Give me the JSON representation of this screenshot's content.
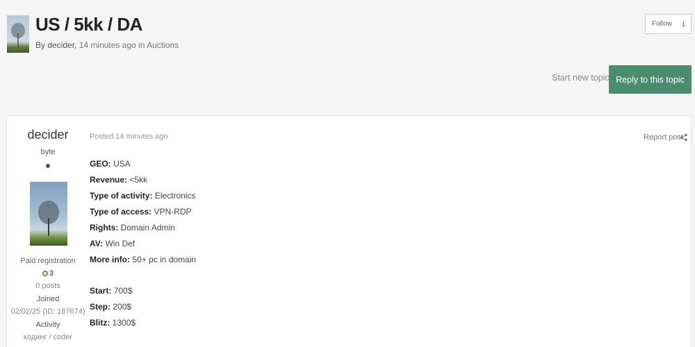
{
  "topic": {
    "title": "US / 5kk / DA",
    "by_prefix": "By",
    "author": "decider,",
    "time": "14 minutes ago",
    "in_word": "in",
    "forum": "Auctions"
  },
  "follow": {
    "label": "Follow",
    "count": "1"
  },
  "actions": {
    "start_new_topic": "Start new topic",
    "reply": "Reply to this topic"
  },
  "post": {
    "author": {
      "name": "decider",
      "rank": "byte",
      "group": "Paid registration",
      "reputation": "3",
      "posts": "0 posts",
      "joined_label": "Joined",
      "joined_value": "02/02/25 (ID: 187674)",
      "activity_label": "Activity",
      "activity_value": "кодинг / coder"
    },
    "posted": "Posted 14 minutes ago",
    "report": "Report post",
    "lines": [
      {
        "key": "GEO:",
        "value": "USA"
      },
      {
        "key": "Revenue:",
        "value": "<5kk"
      },
      {
        "key": "Type of activity:",
        "value": "Electronics"
      },
      {
        "key": "Type of access:",
        "value": "VPN-RDP"
      },
      {
        "key": "Rights:",
        "value": "Domain Admin"
      },
      {
        "key": "AV:",
        "value": "Win Def"
      },
      {
        "key": "More info:",
        "value": "50+ pc in domain"
      },
      {
        "key": "Start:",
        "value": "700$"
      },
      {
        "key": "Step:",
        "value": "200$"
      },
      {
        "key": "Blitz:",
        "value": "1300$"
      }
    ]
  },
  "colors": {
    "accent": "#4a8c6e",
    "background": "#f5f5f5"
  },
  "icons": {
    "share": "share-icon",
    "reputation": "reputation-icon"
  }
}
